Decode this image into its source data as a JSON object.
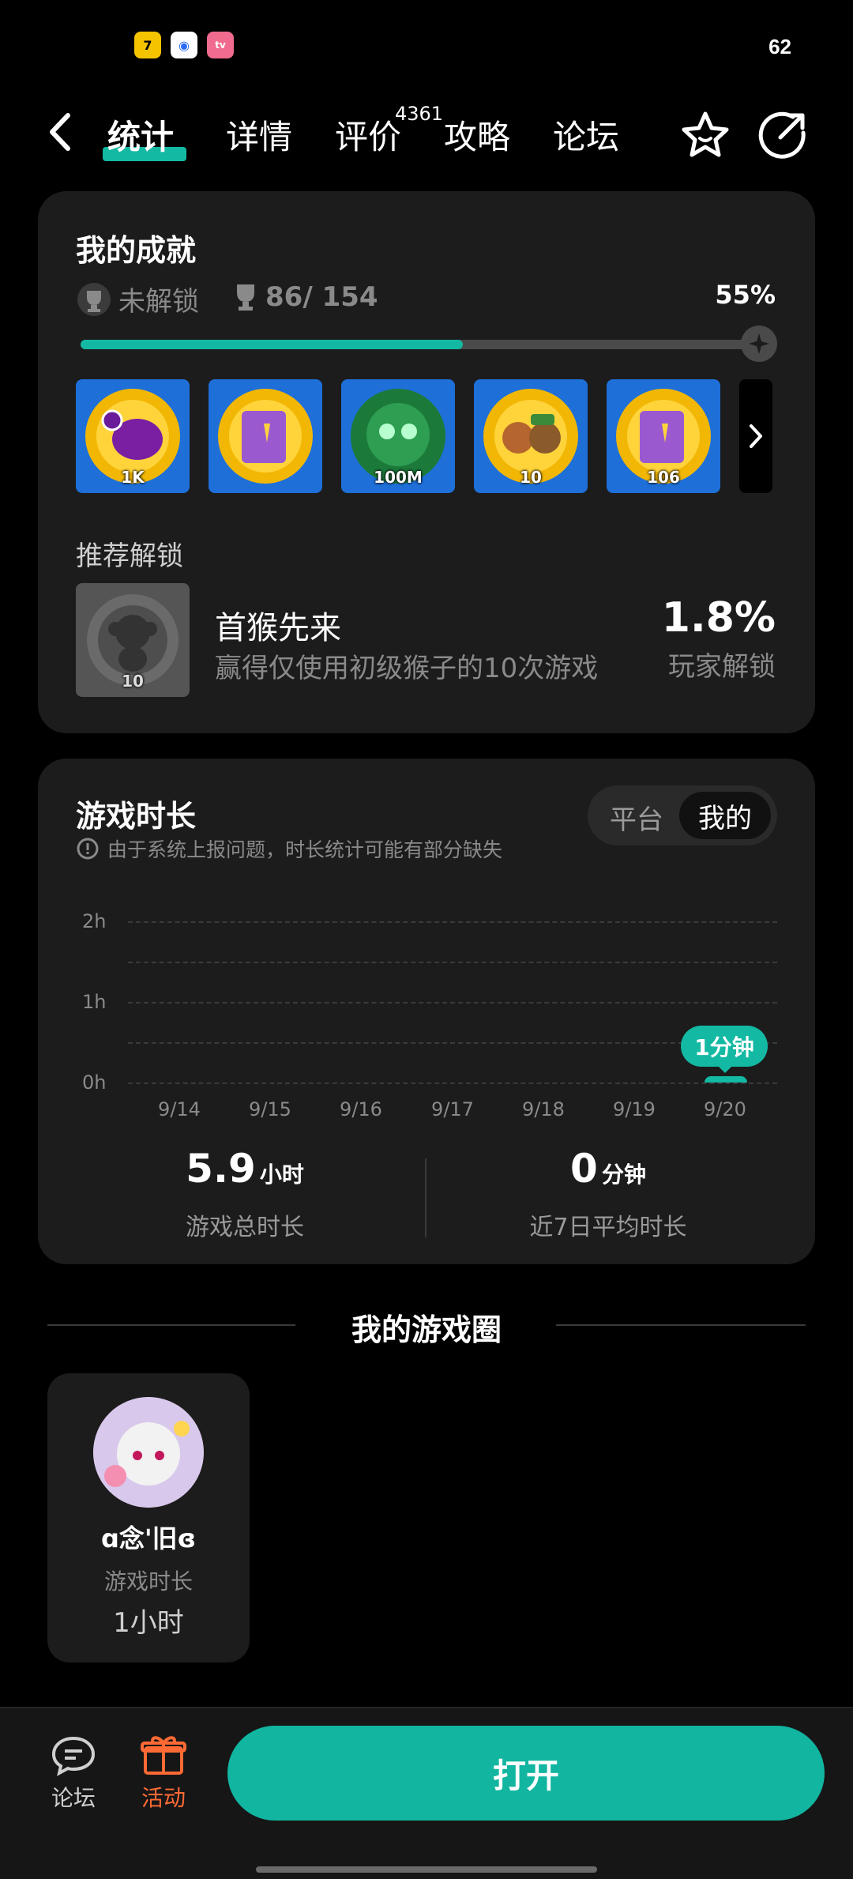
{
  "status": {
    "battery": "62"
  },
  "header": {
    "tabs": [
      {
        "label": "统计",
        "active": true
      },
      {
        "label": "详情"
      },
      {
        "label": "评价",
        "badge": "4361"
      },
      {
        "label": "攻略"
      },
      {
        "label": "论坛"
      }
    ]
  },
  "achievements": {
    "title": "我的成就",
    "unlocked_label": "未解锁",
    "count": "86/ 154",
    "percent": "55%",
    "progress": 0.55,
    "badges": [
      {
        "label": "1K"
      },
      {
        "label": ""
      },
      {
        "label": "100M"
      },
      {
        "label": "10"
      },
      {
        "label": "106"
      }
    ],
    "recommend_title": "推荐解锁",
    "recommend": {
      "name": "首猴先来",
      "desc": "赢得仅使用初级猴子的10次游戏",
      "badge_label": "10",
      "rate": "1.8%",
      "rate_label": "玩家解锁"
    }
  },
  "playtime": {
    "title": "游戏时长",
    "notice": "由于系统上报问题，时长统计可能有部分缺失",
    "toggle": {
      "platform": "平台",
      "mine": "我的"
    },
    "total_value": "5.9",
    "total_unit": "小时",
    "total_label": "游戏总时长",
    "avg_value": "0",
    "avg_unit": "分钟",
    "avg_label": "近7日平均时长"
  },
  "chart_data": {
    "type": "bar",
    "categories": [
      "9/14",
      "9/15",
      "9/16",
      "9/17",
      "9/18",
      "9/19",
      "9/20"
    ],
    "values": [
      0,
      0,
      0,
      0,
      0,
      0,
      0.0167
    ],
    "yticks": [
      "0h",
      "1h",
      "2h"
    ],
    "ylim": [
      0,
      2
    ],
    "tooltip": "1分钟",
    "grid": true
  },
  "circle": {
    "title": "我的游戏圈",
    "user": {
      "name": "ɑ念'旧ɞ",
      "time_label": "游戏时长",
      "time_value": "1小时"
    }
  },
  "bottom": {
    "forum_label": "论坛",
    "activity_label": "活动",
    "open_label": "打开"
  },
  "colors": {
    "accent": "#13b9a3",
    "activity": "#ff6a35",
    "badge_bg": "#1e6fd8"
  }
}
